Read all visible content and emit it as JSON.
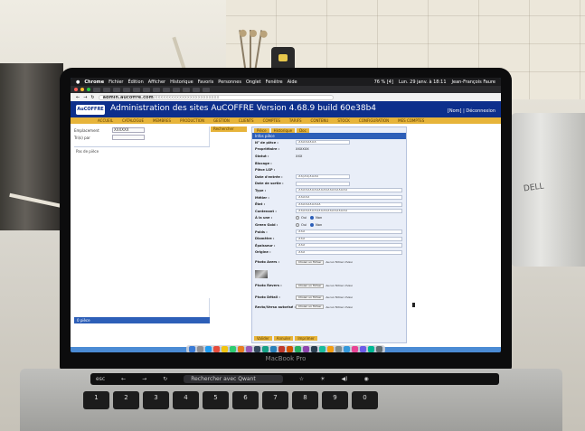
{
  "menubar": {
    "app": "Chrome",
    "menus": [
      "Fichier",
      "Édition",
      "Afficher",
      "Historique",
      "Favoris",
      "Personnes",
      "Onglet",
      "Fenêtre",
      "Aide"
    ],
    "status": [
      "76 % [4]",
      "Lun. 29 janv. à 18:11",
      "Jean-François Faure"
    ]
  },
  "browser": {
    "url_host": "admin.aucoffre.com",
    "url_path": "/xxxxxxxxxxxxxxxxxxxxxxxx"
  },
  "app": {
    "logo": "AuCOFFRE",
    "title": "Administration des sites AuCOFFRE  Version 4.68.9 build 60e38b4",
    "user_label": "[Nom] | Déconnexion",
    "nav": [
      "ACCUEIL",
      "CATALOGUE",
      "MEMBRES",
      "PRODUCTION",
      "GESTION",
      "CLIENTS",
      "COMPTES",
      "TARIFS",
      "CONTENU",
      "STOCK",
      "CONFIGURATION",
      "MES COMPTES"
    ]
  },
  "left_panel": {
    "filters": [
      {
        "label": "Emplacement",
        "value": "XXXXXX"
      },
      {
        "label": "Tri(s) par",
        "value": ""
      }
    ],
    "list_caption": "Pas de pièce",
    "footer": "0 pièce"
  },
  "mid_button": "Rechercher",
  "form": {
    "tabs": [
      "Pièce",
      "Historique",
      "Doc"
    ],
    "header": "Infos pièce",
    "fields": [
      {
        "label": "N° de pièce :",
        "value": "XXXXXXXX"
      },
      {
        "label": "Propriétaire :",
        "value": "XXXXXX"
      },
      {
        "label": "Statut :",
        "value": "XXX"
      },
      {
        "label": "Blocage :",
        "value": ""
      },
      {
        "label": "Pièce LSP :",
        "value": ""
      },
      {
        "label": "Date d'entrée :",
        "value": "XX/XX/XXXX"
      },
      {
        "label": "Date de sortie :",
        "value": ""
      },
      {
        "label": "Type :",
        "value": "XXXXXXXXXXXXXXXXXXXXXX"
      },
      {
        "label": "Métier :",
        "value": "XXXXX"
      },
      {
        "label": "État :",
        "value": "XXXXXXXXXX"
      },
      {
        "label": "Contenant :",
        "value": "XXXXXXXXXXXXXXXXXXXXXX"
      },
      {
        "label": "À la une :",
        "value": ""
      },
      {
        "label": "Green Gold :",
        "value": ""
      },
      {
        "label": "Poids :",
        "value": "XXX"
      },
      {
        "label": "Diamètre :",
        "value": "XXX"
      },
      {
        "label": "Épaisseur :",
        "value": "XXX"
      },
      {
        "label": "Origine :",
        "value": "XXX"
      },
      {
        "label": "Photo Avers :",
        "value": ""
      },
      {
        "label": "Photo Revers :",
        "value": ""
      },
      {
        "label": "Photo Détail :",
        "value": ""
      },
      {
        "label": "Recto/Verso autorisé :",
        "value": ""
      }
    ],
    "radio_yes": "Oui",
    "radio_no": "Non",
    "file_button": "Choisir un fichier",
    "file_none": "Aucun fichier choisi",
    "footer_buttons": [
      "Valider",
      "Annuler",
      "Imprimer"
    ]
  },
  "touchbar": {
    "esc": "esc",
    "search": "Rechercher avec Qwant"
  },
  "keyboard": [
    "1",
    "2",
    "3",
    "4",
    "5",
    "6",
    "7",
    "8",
    "9",
    "0"
  ],
  "laptop_label": "MacBook Pro",
  "side_brand": "DELL"
}
